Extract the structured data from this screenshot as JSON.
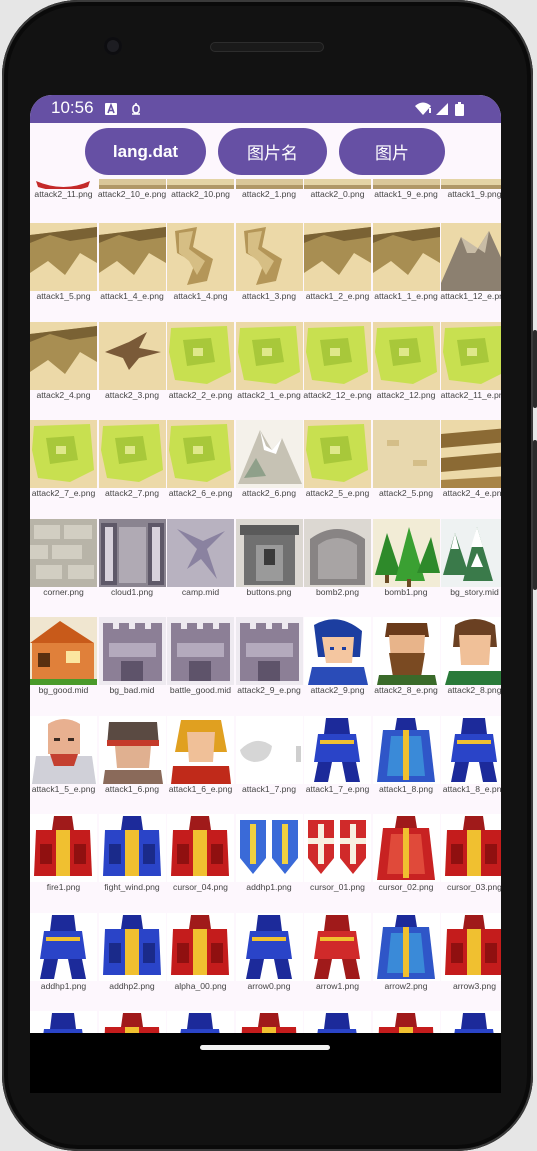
{
  "status_bar": {
    "time": "10:56"
  },
  "buttons": [
    "lang.dat",
    "图片名",
    "图片"
  ],
  "first_row_labels": [
    "attack2_11.png",
    "attack2_10_e.png",
    "attack2_10.png",
    "attack2_1.png",
    "attack2_0.png",
    "attack1_9_e.png",
    "attack1_9.png"
  ],
  "rows": [
    {
      "labels": [
        "attack1_5.png",
        "attack1_4_e.png",
        "attack1_4.png",
        "attack1_3.png",
        "attack1_2_e.png",
        "attack1_1_e.png",
        "attack1_12_e.png"
      ],
      "kinds": [
        "cliff",
        "cliff",
        "path",
        "path",
        "cliff",
        "cliff",
        "mountain"
      ]
    },
    {
      "labels": [
        "attack2_4.png",
        "attack2_3.png",
        "attack2_2_e.png",
        "attack2_1_e.png",
        "attack2_12_e.png",
        "attack2_12.png",
        "attack2_11_e.png"
      ],
      "kinds": [
        "cliff",
        "dragon",
        "grass",
        "grass",
        "grass",
        "grass",
        "grass"
      ]
    },
    {
      "labels": [
        "attack2_7_e.png",
        "attack2_7.png",
        "attack2_6_e.png",
        "attack2_6.png",
        "attack2_5_e.png",
        "attack2_5.png",
        "attack2_4_e.png"
      ],
      "kinds": [
        "grass",
        "grass",
        "grass",
        "snowmtn",
        "grass",
        "sand",
        "ridge"
      ]
    },
    {
      "labels": [
        "corner.png",
        "cloud1.png",
        "camp.mid",
        "buttons.png",
        "bomb2.png",
        "bomb1.png",
        "bg_story.mid"
      ],
      "kinds": [
        "stone",
        "pillar",
        "crack",
        "tower",
        "tower2",
        "trees",
        "snowtrees"
      ]
    },
    {
      "labels": [
        "bg_good.mid",
        "bg_bad.mid",
        "battle_good.mid",
        "attack2_9_e.png",
        "attack2_9.png",
        "attack2_8_e.png",
        "attack2_8.png"
      ],
      "kinds": [
        "house",
        "castle",
        "castle",
        "castle",
        "hero",
        "beard",
        "face"
      ]
    },
    {
      "labels": [
        "attack1_5_e.png",
        "attack1_6.png",
        "attack1_6_e.png",
        "attack1_7.png",
        "attack1_7_e.png",
        "attack1_8.png",
        "attack1_8_e.png"
      ],
      "kinds": [
        "bald",
        "helm",
        "gold",
        "smoke",
        "knightb",
        "cloakb",
        "knightb"
      ]
    },
    {
      "labels": [
        "fire1.png",
        "fight_wind.png",
        "cursor_04.png",
        "addhp1.png",
        "cursor_01.png",
        "cursor_02.png",
        "cursor_03.png"
      ],
      "kinds": [
        "robered",
        "robeblue",
        "robered",
        "shieldb",
        "shieldr",
        "cloakr",
        "robered"
      ]
    },
    {
      "labels": [
        "addhp1.png",
        "addhp2.png",
        "alpha_00.png",
        "arrow0.png",
        "arrow1.png",
        "arrow2.png",
        "arrow3.png"
      ],
      "kinds": [
        "knightb",
        "robeblue",
        "robered",
        "knightb",
        "knightr",
        "cloakb",
        "robered"
      ]
    },
    {
      "labels": [
        "",
        "",
        "",
        "",
        "",
        "",
        ""
      ],
      "kinds": [
        "knightb",
        "robered",
        "knightb",
        "robered",
        "knightb",
        "robered",
        "knightb"
      ]
    }
  ]
}
